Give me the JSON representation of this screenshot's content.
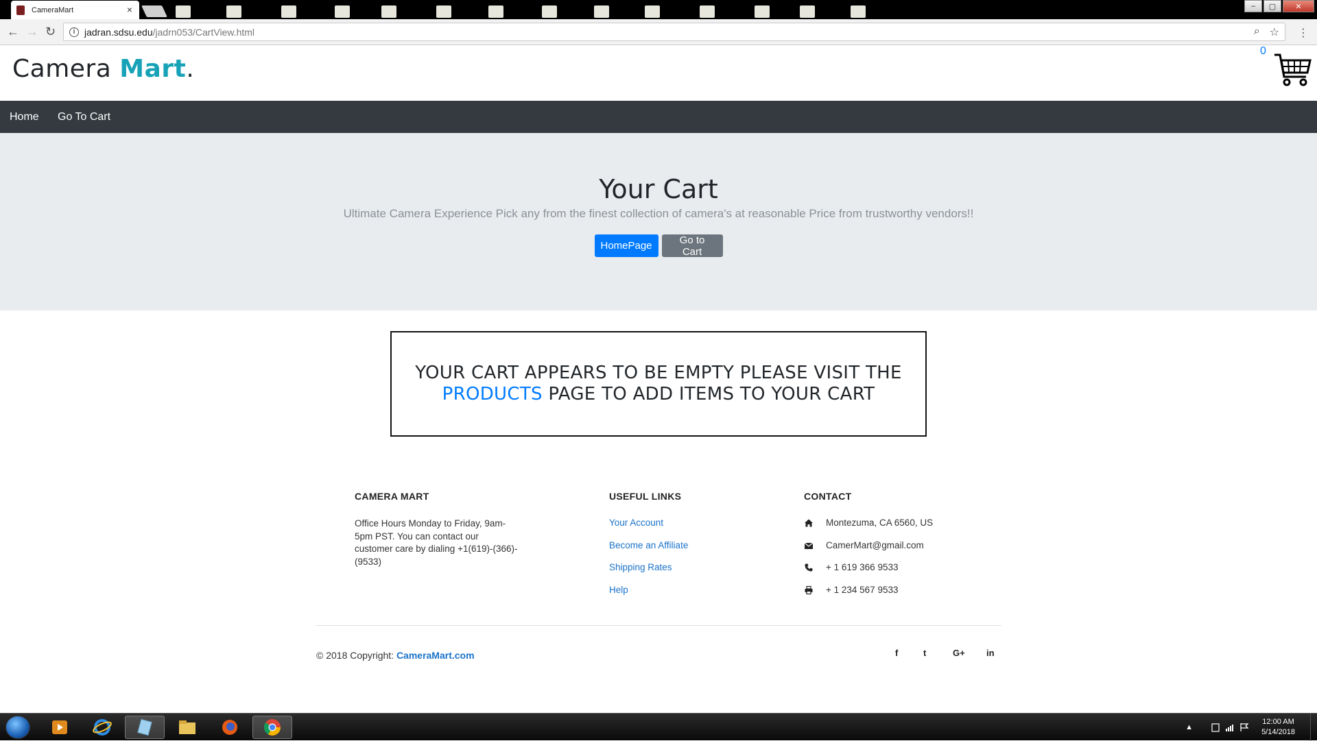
{
  "browser": {
    "tab_title": "CameraMart",
    "tab_close": "×",
    "url_host": "jadran.sdsu.edu",
    "url_path": "/jadrn053/CartView.html",
    "back": "←",
    "forward": "→",
    "reload": "↻",
    "zoom_icon": "⌕",
    "star_icon": "☆",
    "menu_icon": "⋮",
    "win_min": "–",
    "win_restore": "▢",
    "win_close": "✕"
  },
  "header": {
    "brand_main": "Camera ",
    "brand_accent": "Mart",
    "brand_dot": ".",
    "cart_count": "0"
  },
  "nav": {
    "home": "Home",
    "go_to_cart": "Go To Cart"
  },
  "hero": {
    "title": "Your Cart",
    "lead": "Ultimate Camera Experience Pick any from the finest collection of camera's at reasonable Price from trustworthy vendors!!",
    "btn_home": "HomePage",
    "btn_cart": "Go to Cart"
  },
  "empty_cart": {
    "line1": "YOUR CART APPEARS TO BE EMPTY PLEASE VISIT THE",
    "link": "PRODUCTS",
    "line2_rest": " PAGE TO ADD ITEMS TO YOUR CART"
  },
  "footer": {
    "col1_title": "CAMERA MART",
    "col1_text": "Office Hours Monday to Friday, 9am-5pm PST. You can contact our customer care by dialing +1(619)-(366)-(9533)",
    "col2_title": "USEFUL LINKS",
    "links": [
      "Your Account",
      "Become an Affiliate",
      "Shipping Rates",
      "Help"
    ],
    "col3_title": "CONTACT",
    "contact": {
      "address": "Montezuma, CA 6560, US",
      "email": "CamerMart@gmail.com",
      "phone": "+ 1 619 366 9533",
      "fax": "+ 1 234 567 9533"
    },
    "copyright_prefix": "© 2018 Copyright: ",
    "copyright_link": "CameraMart.com",
    "social": {
      "facebook": "f",
      "twitter": "t",
      "googleplus": "G+",
      "linkedin": "in"
    }
  },
  "taskbar": {
    "time": "12:00 AM",
    "date": "5/14/2018",
    "tray_up": "▲"
  },
  "colors": {
    "brand_accent": "#17a2b8",
    "primary": "#007bff",
    "secondary": "#6c757d",
    "navbar": "#343a40",
    "jumbotron": "#e9ecef"
  }
}
